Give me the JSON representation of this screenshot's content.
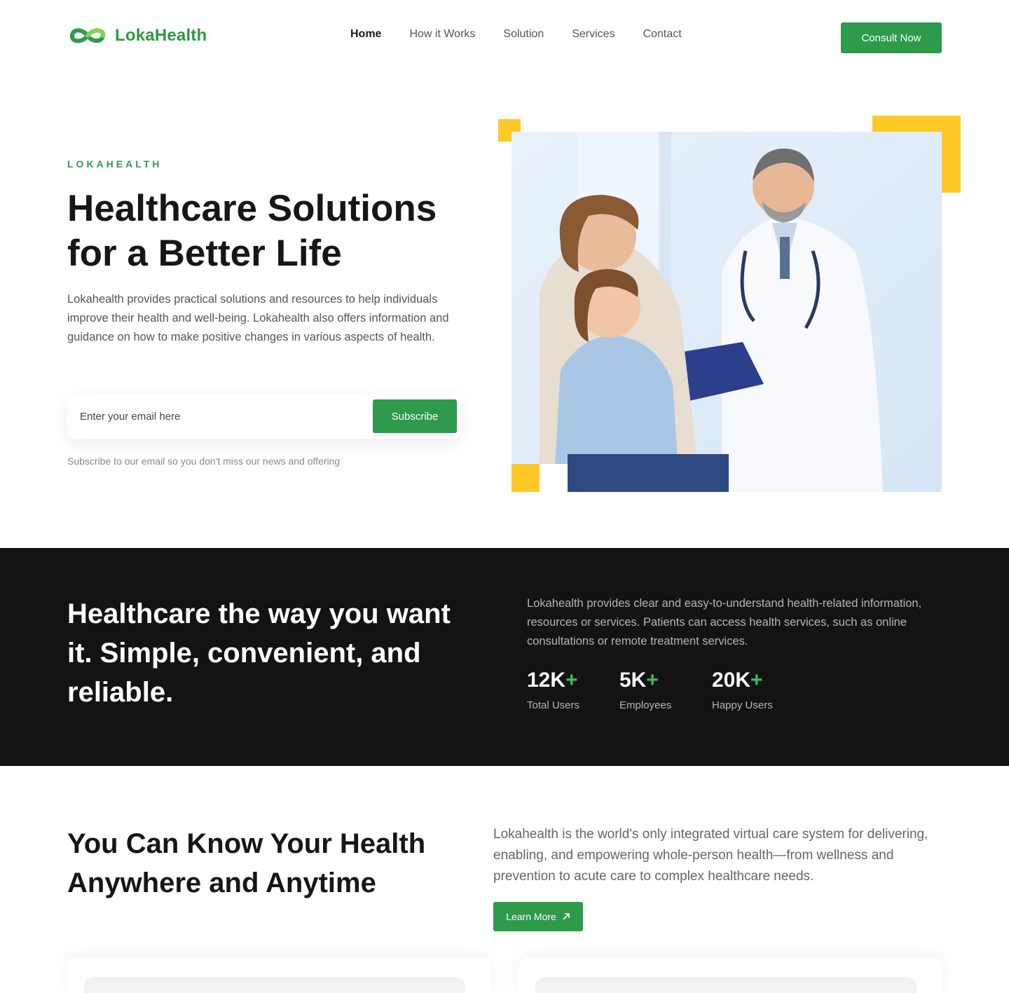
{
  "brand": {
    "name": "LokaHealth",
    "accent": "#2e9a4c",
    "yellow": "#ffc928",
    "dark": "#131313"
  },
  "nav": {
    "links": [
      {
        "label": "Home",
        "active": true
      },
      {
        "label": "How it Works",
        "active": false
      },
      {
        "label": "Solution",
        "active": false
      },
      {
        "label": "Services",
        "active": false
      },
      {
        "label": "Contact",
        "active": false
      }
    ],
    "cta": "Consult Now"
  },
  "hero": {
    "eyebrow": "LOKAHEALTH",
    "title_line1": "Healthcare Solutions",
    "title_line2": "for a Better Life",
    "description": "Lokahealth provides practical solutions and resources to help individuals improve their health and well-being. Lokahealth also offers information and guidance on how to make positive changes in various aspects of health.",
    "email_placeholder": "Enter your email here",
    "subscribe_label": "Subscribe",
    "subscribe_note": "Subscribe to our email so you don't miss our news and offering",
    "image_icon": "doctor-family-photo"
  },
  "band": {
    "title": "Healthcare the way you want it. Simple, convenient, and reliable.",
    "description": "Lokahealth provides clear and easy-to-understand health-related information, resources or services. Patients can access health services, such as online consultations or remote treatment services.",
    "stats": [
      {
        "number": "12K",
        "suffix": "+",
        "label": "Total Users"
      },
      {
        "number": "5K",
        "suffix": "+",
        "label": "Employees"
      },
      {
        "number": "20K",
        "suffix": "+",
        "label": "Happy Users"
      }
    ]
  },
  "know": {
    "title_line1": "You Can Know Your Health",
    "title_line2": "Anywhere and Anytime",
    "description": "Lokahealth is the world's only integrated virtual care system for delivering, enabling, and empowering whole-person health—from wellness and prevention to acute care to complex healthcare needs.",
    "button_label": "Learn More",
    "button_icon": "arrow-up-right-icon"
  }
}
